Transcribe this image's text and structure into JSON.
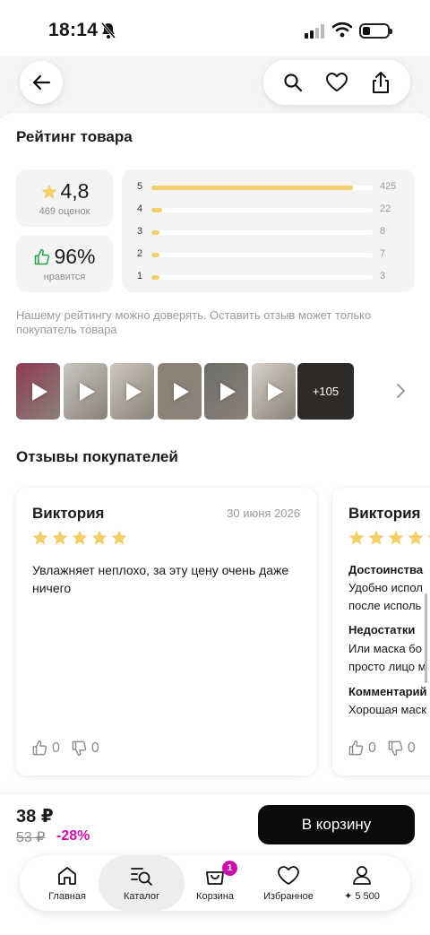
{
  "status_bar": {
    "time": "18:14"
  },
  "rating_section": {
    "title": "Рейтинг товара",
    "average": "4,8",
    "reviews_count": "469 оценок",
    "like_percent": "96%",
    "like_label": "нравится",
    "distribution": [
      {
        "stars": "5",
        "count": "425",
        "fraction": 0.91
      },
      {
        "stars": "4",
        "count": "22",
        "fraction": 0.05
      },
      {
        "stars": "3",
        "count": "8",
        "fraction": 0.02
      },
      {
        "stars": "2",
        "count": "7",
        "fraction": 0.02
      },
      {
        "stars": "1",
        "count": "3",
        "fraction": 0.01
      }
    ],
    "trust_note": "Нашему рейтингу можно доверять. Оставить отзыв может только покупатель товара",
    "media_more": "+105",
    "thumb_colors": [
      "#8e3b55",
      "#c9c6c2",
      "#cfc7bd",
      "#8c8275",
      "#6d6e6a",
      "#d6d2c8"
    ]
  },
  "reviews_section": {
    "title": "Отзывы покупателей",
    "reviews": [
      {
        "author": "Виктория",
        "date": "30 июня 2026",
        "text": "Увлажняет неплохо, за эту цену очень даже ничего",
        "likes": "0",
        "dislikes": "0"
      },
      {
        "author": "Виктория",
        "pros_label": "Достоинства",
        "pros_text_1": "Удобно испол",
        "pros_text_2": "после исполь",
        "cons_label": "Недостатки",
        "cons_text_1": "Или маска бо",
        "cons_text_2": "просто лицо м",
        "comment_label": "Комментарий",
        "comment_text": "Хорошая маск",
        "likes": "0",
        "dislikes": "0"
      }
    ]
  },
  "purchase": {
    "price": "38 ₽",
    "old_price": "53 ₽",
    "discount": "-28%",
    "cart_button": "В корзину"
  },
  "tabbar": {
    "home": "Главная",
    "catalog": "Каталог",
    "cart": "Корзина",
    "cart_badge": "1",
    "favorites": "Избранное",
    "profile": "✦ 5 500"
  },
  "colors": {
    "accent": "#cb11ab",
    "star": "#f2cf6b",
    "like_green": "#22a447"
  }
}
